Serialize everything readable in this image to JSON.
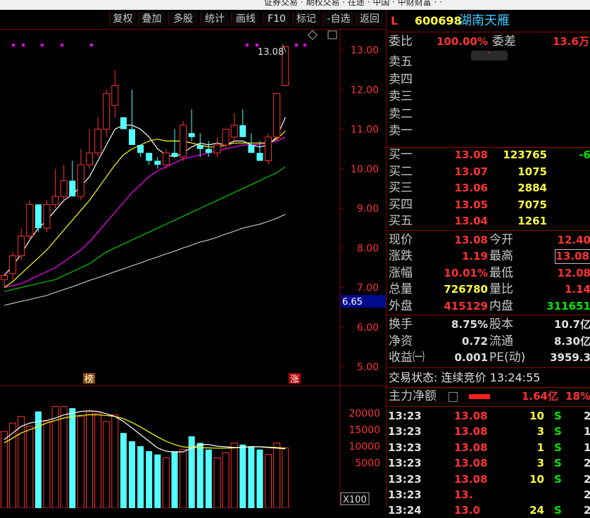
{
  "titlebar": {
    "text": "证券交易 · 期权交易 · 在途 · 中国 · 中财财富 · ·"
  },
  "toolbar": {
    "buttons": [
      "复权",
      "叠加",
      "多股",
      "统计",
      "画线",
      "F10",
      "标记",
      "-自选",
      "返回"
    ]
  },
  "chart": {
    "price_axis": [
      "13.00",
      "12.00",
      "11.00",
      "10.00",
      "9.00",
      "8.00",
      "7.00",
      "6.00",
      "5.00"
    ],
    "current_price_tag": "6.65",
    "high_annotation": "13.08",
    "markers": {
      "bang": "榜",
      "zhang": "涨"
    },
    "volume_axis": [
      "20000",
      "15000",
      "10000",
      "5000"
    ],
    "volume_unit": "X100",
    "colors": {
      "up": "#ff3232",
      "down": "#54ffff",
      "ma5": "#ffffff",
      "ma10": "#ffff00",
      "ma20": "#ff00ff",
      "ma60": "#00cc00",
      "ma120": "#c0c0c0"
    }
  },
  "chart_data": {
    "type": "candlestick",
    "title": "",
    "ylabel": "",
    "ylim": [
      4.8,
      13.3
    ],
    "candles": [
      {
        "o": 7.2,
        "h": 7.35,
        "l": 7.0,
        "c": 7.3
      },
      {
        "o": 7.35,
        "h": 7.9,
        "l": 7.2,
        "c": 7.8
      },
      {
        "o": 7.8,
        "h": 8.5,
        "l": 7.7,
        "c": 8.3
      },
      {
        "o": 8.3,
        "h": 9.2,
        "l": 8.2,
        "c": 9.1
      },
      {
        "o": 9.1,
        "h": 9.0,
        "l": 8.4,
        "c": 8.5
      },
      {
        "o": 8.5,
        "h": 9.2,
        "l": 8.4,
        "c": 9.1
      },
      {
        "o": 9.1,
        "h": 10.0,
        "l": 9.0,
        "c": 9.3
      },
      {
        "o": 9.3,
        "h": 10.1,
        "l": 9.2,
        "c": 9.7
      },
      {
        "o": 9.7,
        "h": 10.2,
        "l": 9.3,
        "c": 9.3
      },
      {
        "o": 9.3,
        "h": 10.5,
        "l": 9.2,
        "c": 10.1
      },
      {
        "o": 10.1,
        "h": 11.0,
        "l": 10.0,
        "c": 10.4
      },
      {
        "o": 10.4,
        "h": 11.3,
        "l": 10.3,
        "c": 11.0
      },
      {
        "o": 11.0,
        "h": 12.0,
        "l": 10.8,
        "c": 11.9
      },
      {
        "o": 11.6,
        "h": 12.5,
        "l": 11.3,
        "c": 12.1
      },
      {
        "o": 11.3,
        "h": 11.2,
        "l": 11.0,
        "c": 11.0
      },
      {
        "o": 11.0,
        "h": 12.0,
        "l": 10.6,
        "c": 10.6
      },
      {
        "o": 10.6,
        "h": 10.6,
        "l": 10.3,
        "c": 10.4
      },
      {
        "o": 10.4,
        "h": 10.4,
        "l": 10.1,
        "c": 10.2
      },
      {
        "o": 10.2,
        "h": 10.3,
        "l": 10.0,
        "c": 10.1
      },
      {
        "o": 10.1,
        "h": 10.5,
        "l": 10.0,
        "c": 10.4
      },
      {
        "o": 10.4,
        "h": 11.0,
        "l": 10.3,
        "c": 10.3
      },
      {
        "o": 10.3,
        "h": 11.2,
        "l": 10.2,
        "c": 11.1
      },
      {
        "o": 10.9,
        "h": 11.5,
        "l": 10.7,
        "c": 10.8
      },
      {
        "o": 10.6,
        "h": 10.9,
        "l": 10.3,
        "c": 10.5
      },
      {
        "o": 10.5,
        "h": 10.7,
        "l": 10.3,
        "c": 10.4
      },
      {
        "o": 10.4,
        "h": 10.8,
        "l": 10.3,
        "c": 10.6
      },
      {
        "o": 10.6,
        "h": 11.0,
        "l": 10.5,
        "c": 11.0
      },
      {
        "o": 10.8,
        "h": 11.4,
        "l": 10.7,
        "c": 11.1
      },
      {
        "o": 11.1,
        "h": 11.5,
        "l": 10.9,
        "c": 10.8
      },
      {
        "o": 10.6,
        "h": 10.9,
        "l": 10.4,
        "c": 10.4
      },
      {
        "o": 10.4,
        "h": 10.7,
        "l": 10.2,
        "c": 10.2
      },
      {
        "o": 10.2,
        "h": 10.9,
        "l": 10.1,
        "c": 10.8
      },
      {
        "o": 10.8,
        "h": 11.9,
        "l": 10.7,
        "c": 11.9
      },
      {
        "o": 12.1,
        "h": 13.08,
        "l": 12.08,
        "c": 13.08
      }
    ],
    "ma5": [
      7.3,
      7.55,
      7.85,
      8.2,
      8.5,
      8.7,
      8.95,
      9.2,
      9.35,
      9.55,
      9.8,
      10.2,
      10.6,
      11.0,
      11.1,
      11.1,
      11.0,
      10.8,
      10.5,
      10.35,
      10.3,
      10.4,
      10.55,
      10.65,
      10.6,
      10.65,
      10.6,
      10.7,
      10.7,
      10.6,
      10.55,
      10.6,
      10.8,
      11.3
    ],
    "ma10": [
      7.0,
      7.15,
      7.35,
      7.55,
      7.75,
      7.95,
      8.2,
      8.45,
      8.7,
      8.95,
      9.2,
      9.5,
      9.8,
      10.1,
      10.35,
      10.5,
      10.6,
      10.7,
      10.75,
      10.7,
      10.7,
      10.7,
      10.65,
      10.6,
      10.55,
      10.55,
      10.6,
      10.65,
      10.65,
      10.65,
      10.65,
      10.65,
      10.75,
      10.95
    ],
    "ma20": [
      7.0,
      7.05,
      7.1,
      7.2,
      7.3,
      7.4,
      7.5,
      7.65,
      7.8,
      7.95,
      8.15,
      8.4,
      8.65,
      8.9,
      9.15,
      9.4,
      9.6,
      9.8,
      9.95,
      10.05,
      10.15,
      10.25,
      10.3,
      10.35,
      10.4,
      10.45,
      10.5,
      10.55,
      10.6,
      10.6,
      10.62,
      10.65,
      10.7,
      10.8
    ],
    "ma60": [
      6.9,
      6.95,
      7.0,
      7.05,
      7.1,
      7.15,
      7.2,
      7.3,
      7.4,
      7.5,
      7.6,
      7.75,
      7.9,
      8.0,
      8.1,
      8.2,
      8.3,
      8.4,
      8.5,
      8.6,
      8.7,
      8.8,
      8.9,
      9.0,
      9.1,
      9.2,
      9.3,
      9.4,
      9.5,
      9.6,
      9.7,
      9.8,
      9.9,
      10.05
    ],
    "ma120": [
      6.55,
      6.6,
      6.65,
      6.7,
      6.75,
      6.8,
      6.88,
      6.95,
      7.02,
      7.1,
      7.18,
      7.25,
      7.32,
      7.4,
      7.47,
      7.55,
      7.62,
      7.7,
      7.77,
      7.85,
      7.92,
      8.0,
      8.07,
      8.15,
      8.2,
      8.27,
      8.35,
      8.42,
      8.5,
      8.55,
      8.6,
      8.67,
      8.75,
      8.85
    ],
    "volume": [
      14500,
      17000,
      19000,
      16000,
      20500,
      17500,
      22000,
      22000,
      21500,
      19000,
      20500,
      20000,
      17500,
      19500,
      14000,
      11500,
      10000,
      8500,
      7500,
      6500,
      8500,
      9000,
      13000,
      11000,
      9000,
      6500,
      8000,
      11000,
      10500,
      10000,
      9000,
      7500,
      11000,
      9500
    ],
    "vol_ma5": [
      12000,
      14000,
      16000,
      17000,
      17500,
      17800,
      18500,
      19500,
      20000,
      20500,
      20700,
      20500,
      19800,
      19000,
      17500,
      15500,
      13500,
      11500,
      9500,
      8500,
      8200,
      8300,
      9500,
      10500,
      10500,
      10000,
      9800,
      9600,
      9700,
      9800,
      9800,
      9600,
      9400,
      9200
    ],
    "vol_ma10": [
      11000,
      12500,
      14000,
      15000,
      16000,
      17000,
      17800,
      18500,
      19000,
      19300,
      19500,
      19500,
      19300,
      19000,
      18300,
      17200,
      15800,
      14300,
      12800,
      11500,
      10500,
      9800,
      9600,
      9600,
      9500,
      9400,
      9400,
      9500,
      9700,
      9800,
      9800,
      9700,
      9600,
      9400
    ],
    "vol_ylim": [
      0,
      24000
    ]
  },
  "quote": {
    "market_flag": "L",
    "code": "600698",
    "name": "湖南天雁",
    "weibi_label": "委比",
    "weibi_value": "100.00%",
    "weicha_label": "委差",
    "weicha_value": "13.6万",
    "sell": [
      {
        "label": "卖五",
        "price": "",
        "vol": ""
      },
      {
        "label": "卖四",
        "price": "",
        "vol": ""
      },
      {
        "label": "卖三",
        "price": "",
        "vol": ""
      },
      {
        "label": "卖二",
        "price": "",
        "vol": ""
      },
      {
        "label": "卖一",
        "price": "",
        "vol": ""
      }
    ],
    "buy": [
      {
        "label": "买一",
        "price": "13.08",
        "vol": "123765",
        "chg": "-6"
      },
      {
        "label": "买二",
        "price": "13.07",
        "vol": "1075",
        "chg": ""
      },
      {
        "label": "买三",
        "price": "13.06",
        "vol": "2884",
        "chg": ""
      },
      {
        "label": "买四",
        "price": "13.05",
        "vol": "7075",
        "chg": ""
      },
      {
        "label": "买五",
        "price": "13.04",
        "vol": "1261",
        "chg": ""
      }
    ],
    "stats": [
      {
        "l1": "现价",
        "v1": "13.08",
        "c1": "red",
        "l2": "今开",
        "v2": "12.40",
        "c2": "red"
      },
      {
        "l1": "涨跌",
        "v1": "1.19",
        "c1": "red",
        "l2": "最高",
        "v2": "13.08",
        "c2": "red"
      },
      {
        "l1": "涨幅",
        "v1": "10.01%",
        "c1": "red",
        "l2": "最低",
        "v2": "12.08",
        "c2": "red"
      },
      {
        "l1": "总量",
        "v1": "726780",
        "c1": "yel",
        "l2": "量比",
        "v2": "1.14",
        "c2": "red"
      },
      {
        "l1": "外盘",
        "v1": "415129",
        "c1": "red",
        "l2": "内盘",
        "v2": "311651",
        "c2": "grn"
      }
    ],
    "stats2": [
      {
        "l1": "换手",
        "v1": "8.75%",
        "l2": "股本",
        "v2": "10.7亿"
      },
      {
        "l1": "净资",
        "v1": "0.72",
        "l2": "流通",
        "v2": "8.30亿"
      },
      {
        "l1": "收益㈠",
        "v1": "0.001",
        "l2": "PE(动)",
        "v2": "3959.3"
      }
    ],
    "trade_status": "交易状态: 连续竞价 13:24:55",
    "main_force_label": "主力净额",
    "main_force_value": "1.64亿",
    "main_force_pct": "18%",
    "ticks": [
      {
        "time": "13:23",
        "price": "13.08",
        "vol": "10",
        "side": "S",
        "n": "2"
      },
      {
        "time": "13:23",
        "price": "13.08",
        "vol": "3",
        "side": "S",
        "n": "1"
      },
      {
        "time": "13:23",
        "price": "13.08",
        "vol": "1",
        "side": "S",
        "n": "1"
      },
      {
        "time": "13:23",
        "price": "13.08",
        "vol": "3",
        "side": "S",
        "n": "2"
      },
      {
        "time": "13:23",
        "price": "13.08",
        "vol": "10",
        "side": "S",
        "n": "2"
      },
      {
        "time": "13:23",
        "price": "13.",
        "vol": "",
        "side": "",
        "n": "2"
      },
      {
        "time": "13:24",
        "price": "13.0",
        "vol": "24",
        "side": "S",
        "n": "2"
      }
    ]
  }
}
